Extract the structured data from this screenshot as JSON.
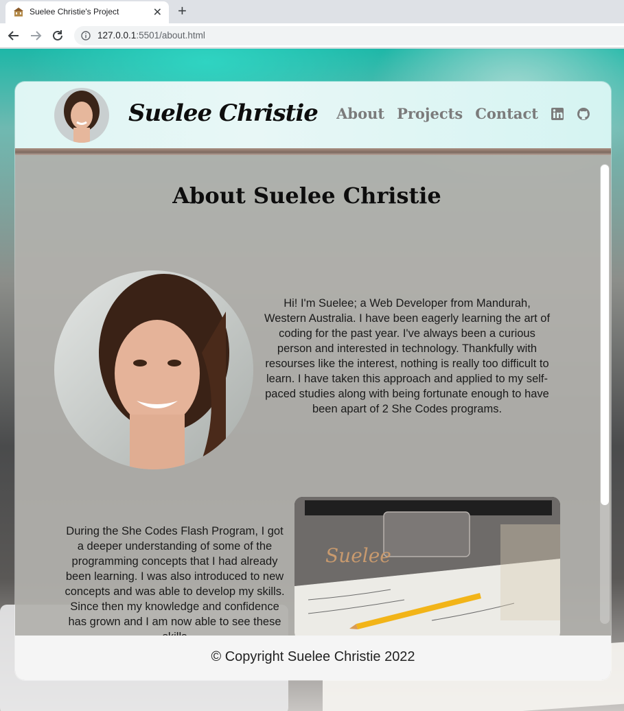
{
  "browser": {
    "tab_title": "Suelee Christie's Project",
    "url_host": "127.0.0.1",
    "url_path": ":5501/about.html"
  },
  "header": {
    "logo": "Suelee Christie",
    "nav": [
      "About",
      "Projects",
      "Contact"
    ],
    "social_icons": [
      "linkedin-icon",
      "github-icon"
    ]
  },
  "main": {
    "title": "About Suelee Christie",
    "bio_paragraph_1": "Hi! I'm Suelee; a Web Developer from Mandurah, Western Australia. I have been eagerly learning the art of coding for the past year. I've always been a curious person and interested in technology. Thankfully with resourses like the interest, nothing is really too difficult to learn. I have taken this approach and applied to my self-paced studies along with being fortunate enough to have been apart of 2 She Codes programs.",
    "bio_paragraph_2": "During the She Codes Flash Program, I got a deeper understanding of some of the programming concepts that I had already been learning. I was also introduced to new concepts and was able to develop my skills. Since then my knowledge and confidence has grown and I am now able to see these skills",
    "laptop_sticker_text": "Suelee"
  },
  "footer": {
    "copyright": "© Copyright Suelee Christie 2022"
  },
  "colors": {
    "nav_link": "#7b7b7b",
    "header_bg": "#dff6f4",
    "card_bg": "#b2b0ac"
  }
}
